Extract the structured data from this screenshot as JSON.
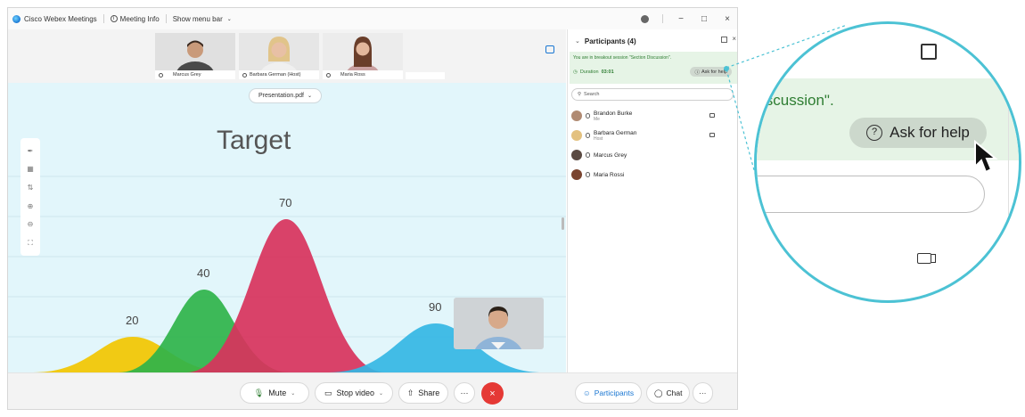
{
  "window": {
    "app_title": "Cisco Webex Meetings",
    "meeting_info": "Meeting Info",
    "menu_bar": "Show menu bar",
    "controls": [
      "−",
      "□",
      "×"
    ]
  },
  "thumbnails": [
    {
      "name": "Marcus Grey"
    },
    {
      "name": "Barbara German (Host)"
    },
    {
      "name": "Maria Ross"
    }
  ],
  "share": {
    "file": "Presentation.pdf",
    "chart_data": {
      "type": "area",
      "title": "Target",
      "categories": [
        "20",
        "40",
        "70",
        "90"
      ],
      "values": [
        20,
        40,
        70,
        90
      ],
      "colors": [
        "#f2c500",
        "#2fb34a",
        "#d8325c",
        "#34b6e4"
      ]
    }
  },
  "panel": {
    "title": "Participants (4)",
    "breakout_text": "You are in breakout session \"Section Discussion\".",
    "duration_label": "Duration",
    "duration_value": "03:01",
    "help_label": "Ask for help",
    "search_placeholder": "Search",
    "participants": [
      {
        "name": "Brandon Burke",
        "sub": "Me",
        "video": true
      },
      {
        "name": "Barbara German",
        "sub": "Host",
        "video": true
      },
      {
        "name": "Marcus Grey",
        "sub": "",
        "video": false
      },
      {
        "name": "Maria Rossi",
        "sub": "",
        "video": false
      }
    ]
  },
  "controls": {
    "mute": "Mute",
    "stop_video": "Stop video",
    "share": "Share",
    "more": "···",
    "end": "×",
    "participants": "Participants",
    "chat": "Chat",
    "panel_more": "···"
  },
  "magnifier": {
    "text": "iscussion\".",
    "help_label": "Ask for help"
  },
  "colors": {
    "accent": "#1976d2",
    "breakout_bg": "#e6f4e6",
    "ring": "#4cc2d4",
    "end_call": "#e53935"
  }
}
